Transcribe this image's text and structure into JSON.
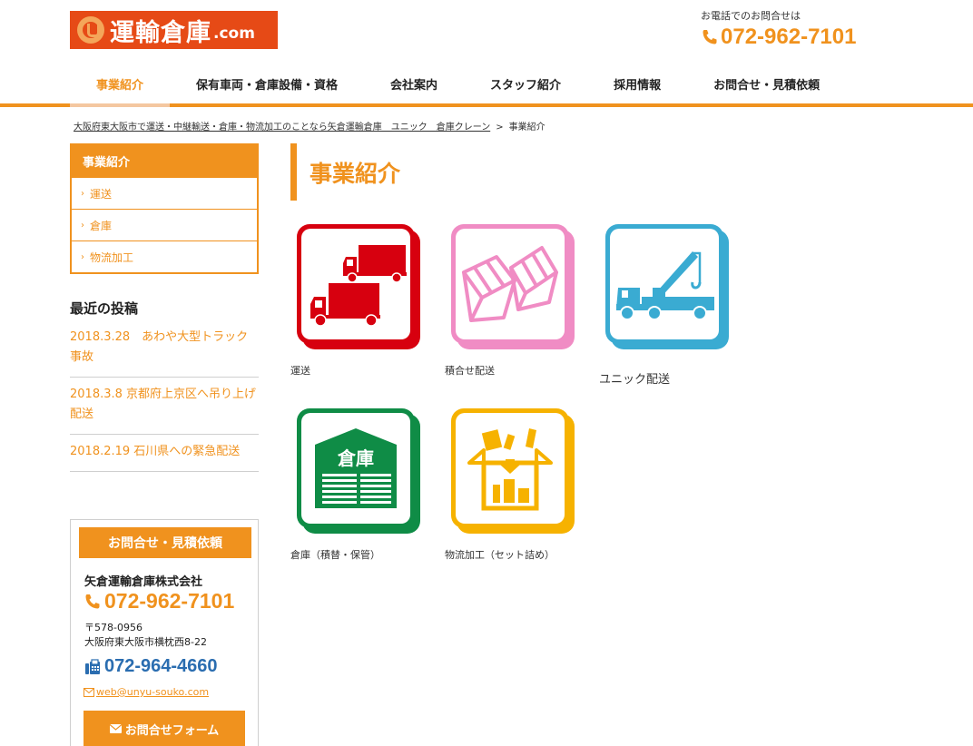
{
  "header": {
    "logo_text": "運輸倉庫",
    "logo_suffix": ".com",
    "tel_caption": "お電話でのお問合せは",
    "tel_number": "072-962-7101"
  },
  "nav": {
    "items": [
      "事業紹介",
      "保有車両・倉庫設備・資格",
      "会社案内",
      "スタッフ紹介",
      "採用情報",
      "お問合せ・見積依頼"
    ],
    "active_index": 0
  },
  "breadcrumb": {
    "home": "大阪府東大阪市で運送・中継輸送・倉庫・物流加工のことなら矢倉運輸倉庫　ユニック　倉庫クレーン",
    "separator": ">",
    "current": "事業紹介"
  },
  "sidebar": {
    "menu_title": "事業紹介",
    "menu_items": [
      "運送",
      "倉庫",
      "物流加工"
    ],
    "recent_title": "最近の投稿",
    "recent_posts": [
      "2018.3.28　あわや大型トラック事故",
      "2018.3.8 京都府上京区へ吊り上げ配送",
      "2018.2.19 石川県への緊急配送"
    ]
  },
  "contact": {
    "heading": "お問合せ・見積依頼",
    "company": "矢倉運輸倉庫株式会社",
    "tel": "072-962-7101",
    "zip": "〒578-0956",
    "address": "大阪府東大阪市横枕西8-22",
    "fax": "072-964-4660",
    "email": "web@unyu-souko.com",
    "form_button": "お問合せフォーム"
  },
  "main": {
    "title": "事業紹介",
    "services": [
      {
        "label": "運送",
        "icon": "trucks-icon",
        "color": "#d7000f"
      },
      {
        "label": "積合せ配送",
        "icon": "boxes-icon",
        "color": "#f08cc4"
      },
      {
        "label": "ユニック配送",
        "icon": "crane-truck-icon",
        "color": "#3aabd2"
      },
      {
        "label": "倉庫（積替・保管）",
        "icon": "warehouse-icon",
        "color": "#0f8c46"
      },
      {
        "label": "物流加工（セット詰め）",
        "icon": "packing-box-icon",
        "color": "#f6b200"
      }
    ],
    "warehouse_sign": "倉庫"
  },
  "colors": {
    "accent": "#f0921e",
    "logo_bg": "#e64a16",
    "fax_blue": "#2a6db0"
  }
}
